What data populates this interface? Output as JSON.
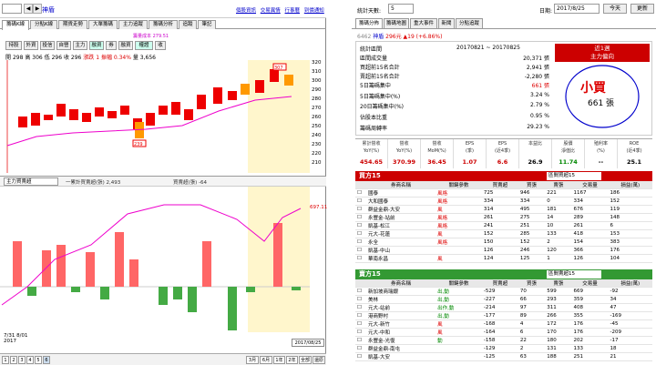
{
  "left": {
    "stock_code": "6462",
    "stock_name": "神盾",
    "top_links": [
      "個股資訊",
      "交易異情",
      "行事曆",
      "到價通知"
    ],
    "tabs": [
      "籌碼K線",
      "分點K線",
      "期貨走勢",
      "大單籌碼",
      "主力追蹤",
      "籌碼分析",
      "追蹤",
      "筆記"
    ],
    "buttons": [
      "持股",
      "外資",
      "投信",
      "自營",
      "主力",
      "融資",
      "券",
      "融資",
      "權證",
      "收"
    ],
    "info": {
      "open_label": "開",
      "open": "298",
      "high_label": "高",
      "high": "306",
      "low_label": "低",
      "low": "296",
      "close_label": "收",
      "close": "296",
      "chg_label": "漲跌",
      "chg": "1",
      "amp_label": "振幅",
      "amp": "0.34%",
      "vol_label": "量",
      "vol": "3,656"
    },
    "cost_note": "籌量成本 279.51",
    "price_axis": [
      "320",
      "310",
      "300",
      "290",
      "280",
      "270",
      "260",
      "250",
      "240",
      "230",
      "220",
      "210"
    ],
    "price_tags": [
      "307",
      "239"
    ],
    "indicator": {
      "name": "主力買賣超",
      "series1_label": "一累計買賣超(張) 2,493",
      "series2_label": "買賣超(張) -64"
    },
    "vol_axis": [
      "697.11"
    ],
    "date_labels": [
      "7/31",
      "8/01",
      "2017"
    ],
    "date_box": "2017/08/25",
    "pages": [
      "1",
      "2",
      "3",
      "4",
      "5",
      "6"
    ],
    "period_buttons": [
      "3月",
      "6月",
      "1年",
      "2年",
      "全部",
      "還原"
    ]
  },
  "right": {
    "count_label": "統計天數:",
    "count_value": "5",
    "date_label": "日期:",
    "date_value": "2017/8/25",
    "today_btn": "今天",
    "refresh_btn": "更新",
    "tabs": [
      "籌碼分佈",
      "籌碼地圖",
      "重大事件",
      "新聞",
      "分點追蹤"
    ],
    "header": {
      "code": "6462",
      "name": "神盾",
      "price": "296元",
      "chg": "▲19 (+6.86%)"
    },
    "summary": [
      {
        "label": "統計區間",
        "value": "20170821 ~ 20170825"
      },
      {
        "label": "區間成交量",
        "value": "20,371 張"
      },
      {
        "label": "買超前15名合計",
        "value": "2,941 張"
      },
      {
        "label": "賣超前15名合計",
        "value": "-2,280 張"
      },
      {
        "label": "5日籌碼集中",
        "value": "661 張"
      },
      {
        "label": "5日籌碼集中(%)",
        "value": "3.24 %"
      },
      {
        "label": "20日籌碼集中(%)",
        "value": "2.79 %"
      },
      {
        "label": "佔股本比重",
        "value": "0.95 %"
      },
      {
        "label": "籌碼周轉率",
        "value": "29.23 %"
      }
    ],
    "badge": {
      "line1": "近1週",
      "line2": "主力偏向",
      "big": "小買",
      "count": "661 張"
    },
    "metrics": [
      {
        "h1": "累計營收",
        "h2": "YoY(%)",
        "v": "454.65"
      },
      {
        "h1": "營收",
        "h2": "YoY(%)",
        "v": "370.99"
      },
      {
        "h1": "營收",
        "h2": "MoM(%)",
        "v": "36.45"
      },
      {
        "h1": "EPS",
        "h2": "(季)",
        "v": "1.07"
      },
      {
        "h1": "EPS",
        "h2": "(近4季)",
        "v": "6.6"
      },
      {
        "h1": "本益比",
        "h2": "",
        "v": "26.9"
      },
      {
        "h1": "股價",
        "h2": "淨值比",
        "v": "11.74"
      },
      {
        "h1": "殖利率",
        "h2": "(%)",
        "v": "--"
      },
      {
        "h1": "ROE",
        "h2": "(近4季)",
        "v": "25.1"
      }
    ],
    "buy_title": "買方15",
    "sell_title": "賣方15",
    "buy_select": "區間買超15",
    "sell_select": "區間賣超15",
    "table_headers": [
      "券商名稱",
      "關鍵參數",
      "買賣超",
      "買張",
      "賣張",
      "交易量",
      "損益(萬)"
    ],
    "buy_rows": [
      [
        "國泰",
        "風格",
        "725",
        "946",
        "221",
        "1167",
        "186"
      ],
      [
        "大和國泰",
        "風格",
        "334",
        "334",
        "0",
        "334",
        "152"
      ],
      [
        "群益金鼎-大安",
        "風",
        "314",
        "495",
        "181",
        "676",
        "119"
      ],
      [
        "永豐金-站前",
        "風格",
        "261",
        "275",
        "14",
        "289",
        "148"
      ],
      [
        "凱基-松江",
        "風格",
        "241",
        "251",
        "10",
        "261",
        "6"
      ],
      [
        "元大-花蓮",
        "風",
        "152",
        "285",
        "133",
        "418",
        "153"
      ],
      [
        "永全",
        "風格",
        "150",
        "152",
        "2",
        "154",
        "383"
      ],
      [
        "凱基-中山",
        "",
        "126",
        "246",
        "120",
        "366",
        "176"
      ],
      [
        "華南永昌",
        "風",
        "124",
        "125",
        "1",
        "126",
        "104"
      ]
    ],
    "sell_rows": [
      [
        "新加坡商瑞銀",
        "出,動",
        "-529",
        "70",
        "599",
        "669",
        "-92"
      ],
      [
        "美林",
        "出,動",
        "-227",
        "66",
        "293",
        "359",
        "34"
      ],
      [
        "元大-站前",
        "出作,動",
        "-214",
        "97",
        "311",
        "408",
        "47"
      ],
      [
        "港商野村",
        "出,動",
        "-177",
        "89",
        "266",
        "355",
        "-169"
      ],
      [
        "元大-新竹",
        "風",
        "-168",
        "4",
        "172",
        "176",
        "-45"
      ],
      [
        "元大-中和",
        "風",
        "-164",
        "6",
        "170",
        "176",
        "-209"
      ],
      [
        "永豐金-光復",
        "動",
        "-158",
        "22",
        "180",
        "202",
        "-17"
      ],
      [
        "群益金鼎-南屯",
        "",
        "-129",
        "2",
        "131",
        "133",
        "18"
      ],
      [
        "凱基-大安",
        "",
        "-125",
        "63",
        "188",
        "251",
        "21"
      ]
    ]
  }
}
